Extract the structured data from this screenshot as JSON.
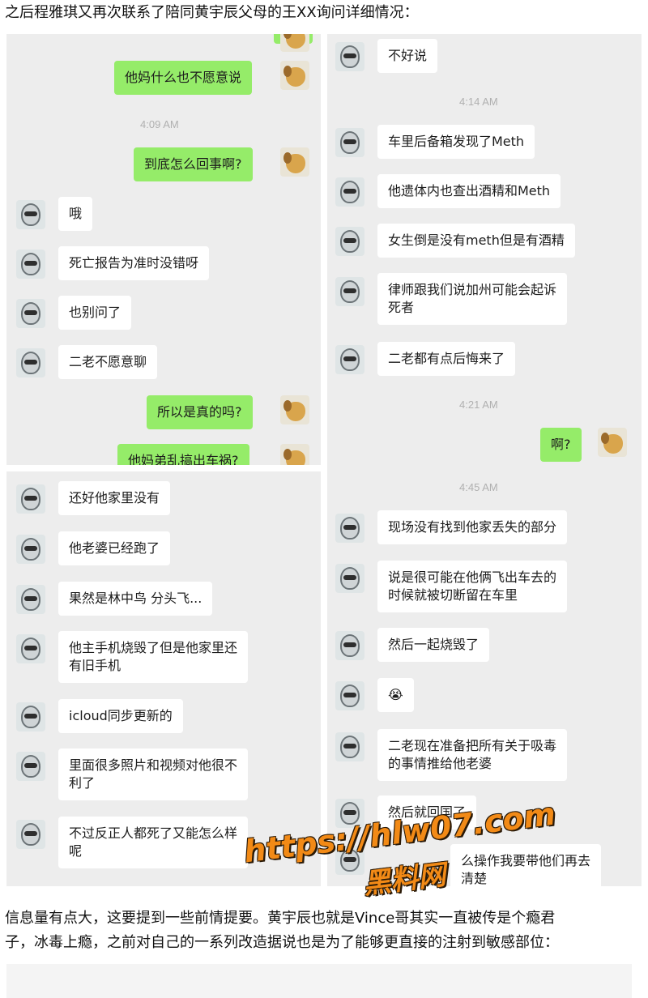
{
  "captions": {
    "top": "之后程雅琪又再次联系了陪同黄宇辰父母的王XX询问详细情况：",
    "bottom_line1": "信息量有点大，这要提到一些前情提要。黄宇辰也就是Vince哥其实一直被传是个瘾君",
    "bottom_line2": "子，冰毒上瘾，之前对自己的一系列改造据说也是为了能够更直接的注射到敏感部位："
  },
  "chat_top_left": {
    "partial_bubble": "",
    "msg1": "他妈什么也不愿意说",
    "time1": "4:09 AM",
    "msg2": "到底怎么回事啊?",
    "msg3": "哦",
    "msg4": "死亡报告为准时没错呀",
    "msg5": "也别问了",
    "msg6": "二老不愿意聊",
    "msg7": "所以是真的吗?",
    "msg8": "他妈弟乱搞出车祸?"
  },
  "chat_top_right": {
    "msg1": "不好说",
    "time1": "4:14 AM",
    "msg2": "车里后备箱发现了Meth",
    "msg3": "他遗体内也查出酒精和Meth",
    "msg4": "女生倒是没有meth但是有酒精",
    "msg5": "律师跟我们说加州可能会起诉\n死者",
    "msg6": "二老都有点后悔来了",
    "time2": "4:21 AM",
    "msg7": "啊?"
  },
  "chat_bottom_left": {
    "msg1": "还好他家里没有",
    "msg2": "他老婆已经跑了",
    "msg3": "果然是林中鸟 分头飞...",
    "msg4": "他主手机烧毁了但是他家里还\n有旧手机",
    "msg5": "icloud同步更新的",
    "msg6": "里面很多照片和视频对他很不\n利了",
    "msg7": "不过反正人都死了又能怎么样\n呢"
  },
  "chat_bottom_right": {
    "time1": "4:45 AM",
    "msg1": "现场没有找到他家丢失的部分",
    "msg2": "说是很可能在他俩飞出车去的\n时候就被切断留在车里",
    "msg3": "然后一起烧毁了",
    "msg4_emoji": "😭",
    "msg5": "二老现在准备把所有关于吸毒\n的事情推给他老婆",
    "msg6": "然后就回国了",
    "msg7": "么操作我要带他们再去\n清楚"
  },
  "watermark": {
    "line1": "https://hlw07.com",
    "line2": "黑料网"
  },
  "icons": {
    "girl_avatar": "girl-avatar-icon",
    "dog_avatar": "dog-avatar-icon"
  },
  "colors": {
    "chat_bg": "#ededed",
    "bubble_mine": "#95ec69",
    "bubble_other": "#ffffff",
    "watermark": "#f28a16"
  }
}
